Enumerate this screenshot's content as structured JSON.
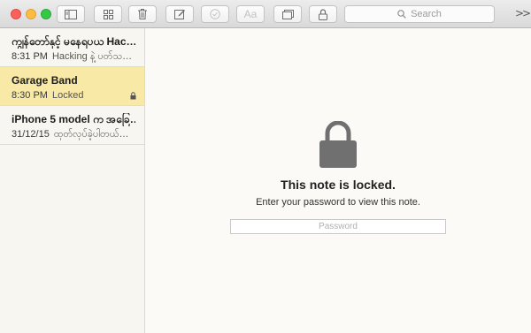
{
  "toolbar": {
    "search_placeholder": "Search",
    "buttons": [
      {
        "icon": "sidebar-toggle-icon"
      },
      {
        "icon": "attachments-grid-icon"
      },
      {
        "icon": "trash-icon"
      },
      {
        "icon": "compose-icon"
      },
      {
        "icon": "checklist-icon"
      },
      {
        "icon": "font-style-icon",
        "label": "Aa"
      },
      {
        "icon": "table-icon"
      },
      {
        "icon": "lock-icon"
      }
    ],
    "overflow_label": ">>"
  },
  "notes": [
    {
      "title": "ကျွန်တော်နှင့် မနေရပယ Hac…",
      "time": "8:31 PM",
      "preview": "Hacking နဲ့ ပတ်သ…",
      "locked": false,
      "selected": false
    },
    {
      "title": "Garage Band",
      "time": "8:30 PM",
      "preview": "Locked",
      "locked": true,
      "selected": true
    },
    {
      "title": "iPhone 5 model က အခြေ…",
      "time": "31/12/15",
      "preview": "ထုတ်လုပ်ခဲ့ပါတယ်…",
      "locked": false,
      "selected": false
    }
  ],
  "main": {
    "locked_title": "This note is locked.",
    "locked_message": "Enter your password to view this note.",
    "password_placeholder": "Password"
  },
  "colors": {
    "selected_note": "#f8e9a6",
    "lock_gray": "#707070",
    "close": "#fc605b",
    "minimize": "#fdbc40",
    "zoom": "#34c84a"
  }
}
